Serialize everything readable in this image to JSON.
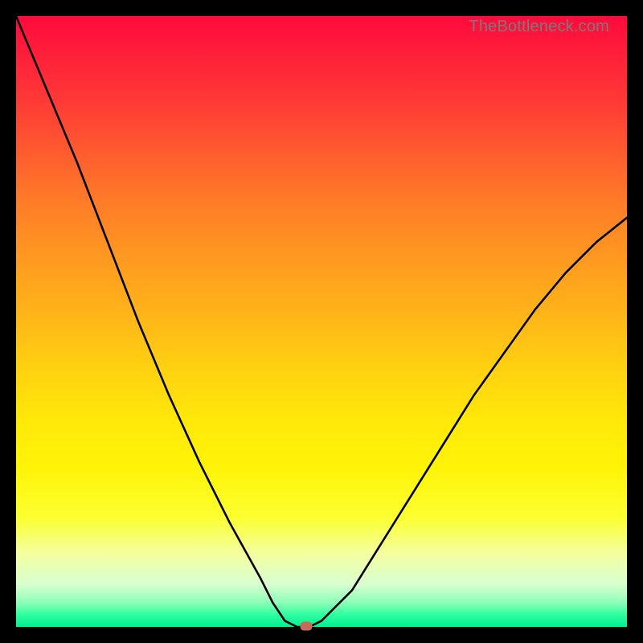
{
  "watermark": "TheBottleneck.com",
  "marker_color": "#c76a5a",
  "chart_data": {
    "type": "line",
    "title": "",
    "xlabel": "",
    "ylabel": "",
    "xlim": [
      0,
      100
    ],
    "ylim": [
      0,
      100
    ],
    "series": [
      {
        "name": "bottleneck-curve",
        "x": [
          0,
          5,
          10,
          15,
          20,
          25,
          30,
          35,
          40,
          42,
          44,
          46,
          48,
          50,
          55,
          60,
          65,
          70,
          75,
          80,
          85,
          90,
          95,
          100
        ],
        "values": [
          100,
          88,
          76,
          63,
          50,
          38,
          27,
          17,
          8,
          4,
          1,
          0,
          0,
          1,
          6,
          14,
          22,
          30,
          38,
          45,
          52,
          58,
          63,
          67
        ]
      }
    ],
    "marker": {
      "x": 47.5,
      "y": 0
    }
  }
}
